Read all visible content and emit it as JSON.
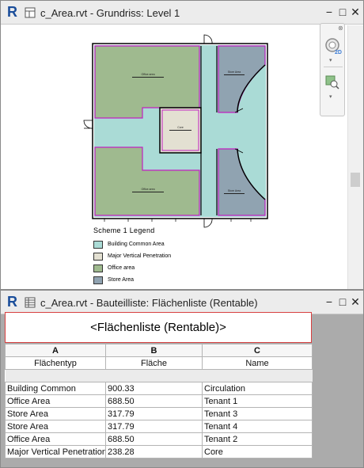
{
  "top_window": {
    "title": "c_Area.rvt - Grundriss: Level 1",
    "nav_zoom_label": "2D",
    "rooms": [
      {
        "id": "office-nw",
        "tag": "Office area"
      },
      {
        "id": "office-sw",
        "tag": "Office area"
      },
      {
        "id": "core",
        "tag": "Core"
      },
      {
        "id": "store-ne",
        "tag": "Store Area"
      },
      {
        "id": "store-se",
        "tag": "Store Area"
      }
    ],
    "legend": {
      "title": "Scheme 1 Legend",
      "items": [
        {
          "label": "Building Common Area",
          "color": "#aadbd6"
        },
        {
          "label": "Major Vertical Penetration",
          "color": "#e3e0d2"
        },
        {
          "label": "Office area",
          "color": "#9fba8f"
        },
        {
          "label": "Store Area",
          "color": "#90a3b1"
        }
      ]
    }
  },
  "bottom_window": {
    "title": "c_Area.rvt - Bauteilliste: Flächenliste (Rentable)",
    "schedule_title": "<Flächenliste (Rentable)>",
    "column_letters": [
      "A",
      "B",
      "C"
    ],
    "column_names": [
      "Flächentyp",
      "Fläche",
      "Name"
    ],
    "rows": [
      [
        "Building Common",
        "900.33",
        "Circulation"
      ],
      [
        "Office Area",
        "688.50",
        "Tenant 1"
      ],
      [
        "Store Area",
        "317.79",
        "Tenant 3"
      ],
      [
        "Store Area",
        "317.79",
        "Tenant 4"
      ],
      [
        "Office Area",
        "688.50",
        "Tenant 2"
      ],
      [
        "Major Vertical Penetration",
        "238.28",
        "Core"
      ]
    ]
  },
  "colors": {
    "area_boundary": "#c020c0",
    "schedule_title_border": "#d84040",
    "revit_logo": "#1a4d9a"
  }
}
